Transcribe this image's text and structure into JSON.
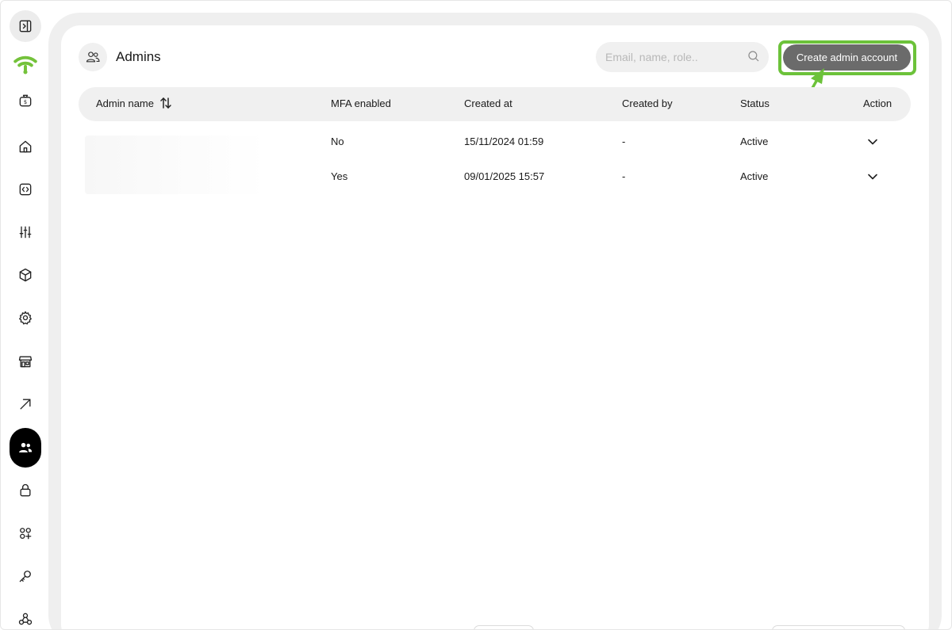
{
  "colors": {
    "accent": "#6cc23a",
    "brand_wifi": "#74c23b",
    "button_bg": "#6b6b6b"
  },
  "sidebar": {
    "items": [
      {
        "icon": "sidebar-toggle-icon"
      },
      {
        "icon": "wifi-logo-icon"
      },
      {
        "icon": "money-bag-icon"
      },
      {
        "icon": "home-icon"
      },
      {
        "icon": "code-icon"
      },
      {
        "icon": "sliders-icon"
      },
      {
        "icon": "cube-icon"
      },
      {
        "icon": "gear-icon"
      },
      {
        "icon": "store-icon"
      },
      {
        "icon": "arrow-up-right-icon"
      },
      {
        "icon": "users-icon",
        "active": true
      },
      {
        "icon": "lock-icon"
      },
      {
        "icon": "apps-add-icon"
      },
      {
        "icon": "key-icon"
      },
      {
        "icon": "webhook-icon"
      }
    ]
  },
  "header": {
    "title": "Admins",
    "search_placeholder": "Email, name, role..",
    "create_button": "Create admin account"
  },
  "table": {
    "columns": [
      "Admin name",
      "MFA enabled",
      "Created at",
      "Created by",
      "Status",
      "Action"
    ],
    "rows": [
      {
        "mfa": "No",
        "created_at": "15/11/2024 01:59",
        "created_by": "-",
        "status": "Active"
      },
      {
        "mfa": "Yes",
        "created_at": "09/01/2025 15:57",
        "created_by": "-",
        "status": "Active"
      }
    ]
  }
}
